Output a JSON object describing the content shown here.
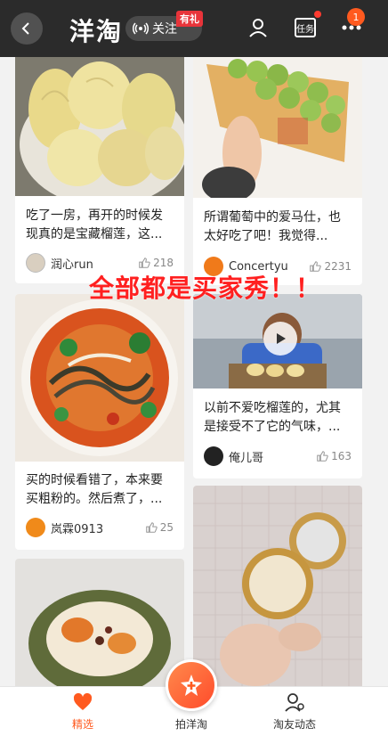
{
  "header": {
    "title": "洋淘",
    "follow_label": "关注",
    "gift_badge": "有礼",
    "task_label": "任务",
    "more_badge_count": "1"
  },
  "overlay": {
    "text": "全部都是买家秀！！"
  },
  "feed": {
    "left": [
      {
        "desc": "吃了一房，再开的时候发现真的是宝藏榴莲，这...",
        "author": "润心run",
        "likes": "218"
      },
      {
        "desc": "买的时候看错了，本来要买粗粉的。然后煮了，...",
        "author": "岚霖0913",
        "likes": "25"
      },
      {
        "desc": "",
        "author": "",
        "likes": ""
      }
    ],
    "right": [
      {
        "desc": "所谓葡萄中的爱马仕，也太好吃了吧！我觉得...",
        "author": "Concertyu",
        "likes": "2231"
      },
      {
        "desc": "以前不爱吃榴莲的，尤其是接受不了它的气味，...",
        "author": "俺儿哥",
        "likes": "163"
      },
      {
        "desc": "",
        "author": "",
        "likes": ""
      }
    ]
  },
  "bottom_nav": {
    "tabs": [
      {
        "label": "精选",
        "active": true
      },
      {
        "label": "拍洋淘",
        "active": false
      },
      {
        "label": "淘友动态",
        "active": false
      }
    ]
  },
  "colors": {
    "header_bg": "#2b2b2b",
    "accent": "#ff5a1f",
    "overlay_text": "#ff2020",
    "active_tab": "#ff5a1f"
  }
}
